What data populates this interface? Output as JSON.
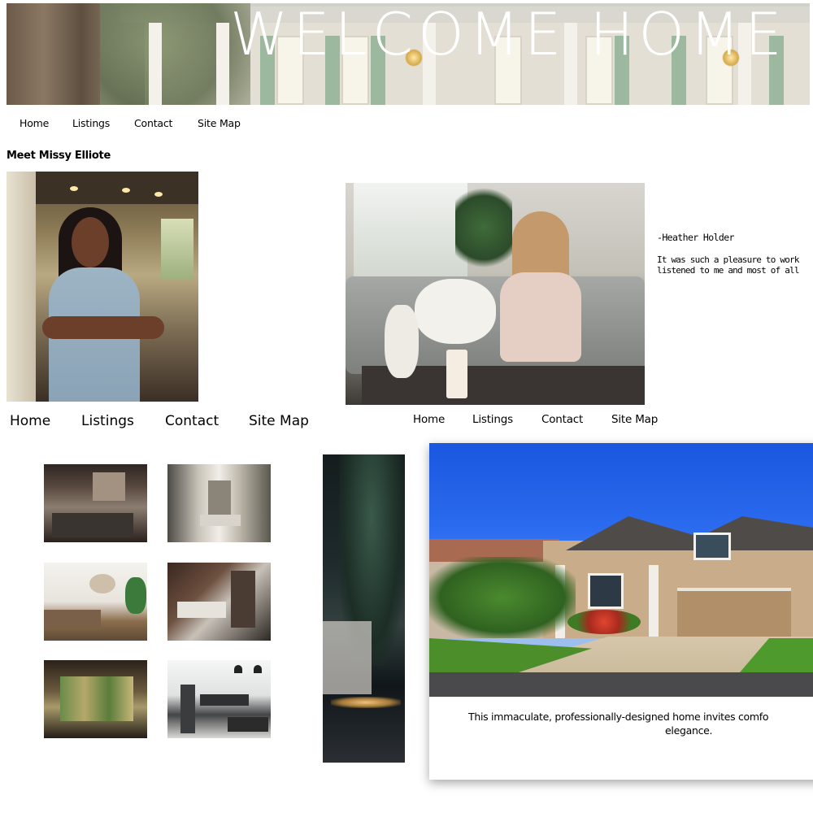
{
  "banner": {
    "title": "WELCOME HOME"
  },
  "nav_top": {
    "items": [
      {
        "label": "Home"
      },
      {
        "label": "Listings"
      },
      {
        "label": "Contact"
      },
      {
        "label": "Site Map"
      }
    ]
  },
  "agent": {
    "heading": "Meet Missy Elliote"
  },
  "testimonial": {
    "author": "-Heather Holder",
    "text_line1": "It was such a pleasure to work",
    "text_line2": "listened to me and most of all"
  },
  "nav_left": {
    "items": [
      {
        "label": "Home"
      },
      {
        "label": "Listings"
      },
      {
        "label": "Contact"
      },
      {
        "label": "Site Map"
      }
    ]
  },
  "nav_mid": {
    "items": [
      {
        "label": "Home"
      },
      {
        "label": "Listings"
      },
      {
        "label": "Contact"
      },
      {
        "label": "Site Map"
      }
    ]
  },
  "listing": {
    "description_line1": "This immaculate, professionally-designed home invites comfo",
    "description_line2": "elegance."
  },
  "colors": {
    "banner_text": "#ffffff",
    "sky": "#1a57e0",
    "card_shadow": "#595959"
  }
}
